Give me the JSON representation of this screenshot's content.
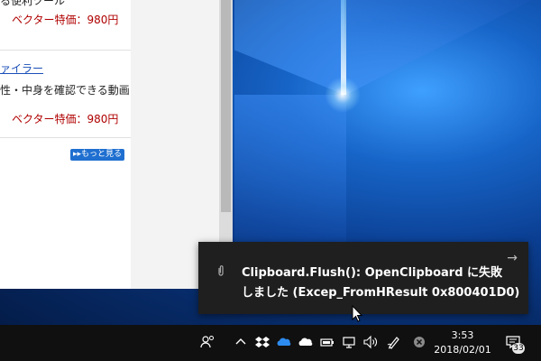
{
  "browser": {
    "items": [
      {
        "title_partial": "る便利ツール",
        "price": "ベクター特価：980円"
      },
      {
        "title_partial": "ァイラー",
        "desc_partial": "性・中身を確認できる動画",
        "price": "ベクター特価：980円"
      }
    ],
    "more_label": "▸▸もっと見る"
  },
  "toast": {
    "line1": "Clipboard.Flush(): OpenClipboard に失敗",
    "line2": "しました (Excep_FromHResult 0x800401D0)",
    "arrow": "→",
    "app_icon": "paperclip-icon"
  },
  "taskbar": {
    "time": "3:53",
    "date": "2018/02/01",
    "notification_count": "33",
    "icons": [
      "people-icon",
      "chevron-up-icon",
      "dropbox-icon",
      "onedrive-icon",
      "onedrive-personal-icon",
      "battery-icon",
      "network-icon",
      "volume-icon",
      "pen-icon",
      "close-circle-icon",
      "action-center-icon"
    ]
  }
}
